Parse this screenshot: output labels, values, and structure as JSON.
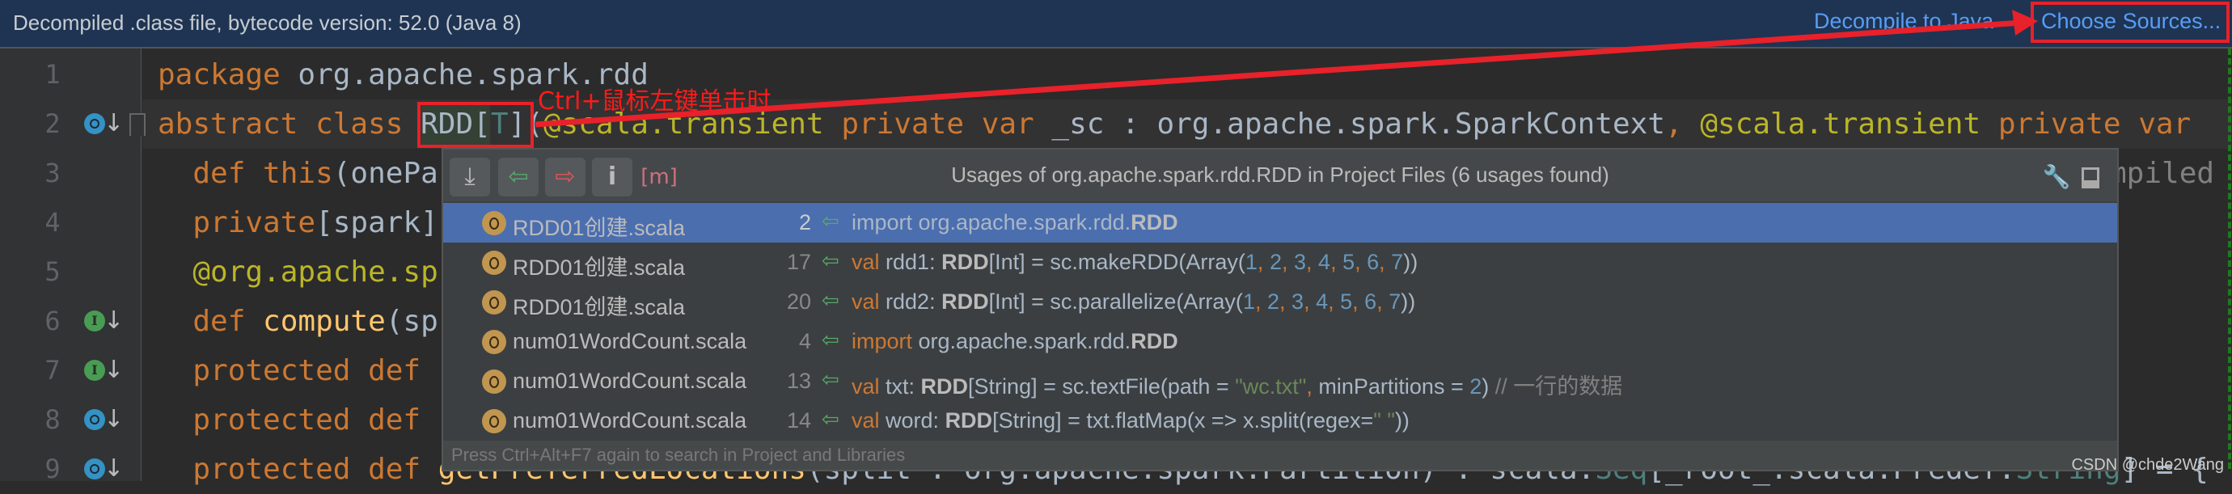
{
  "banner": {
    "message": "Decompiled .class file, bytecode version: 52.0 (Java 8)",
    "decompile_link": "Decompile to Java",
    "choose_sources_link": "Choose Sources..."
  },
  "annotation": {
    "text": "Ctrl+鼠标左键单击时",
    "color": "#ff1a1a"
  },
  "editor": {
    "line_numbers": [
      "1",
      "2",
      "3",
      "4",
      "5",
      "6",
      "7",
      "8",
      "9"
    ],
    "gutter_icons": {
      "2": "overridden-icon",
      "6": "implemented-icon",
      "7": "implemented-icon",
      "8": "overridden-icon",
      "9": "overridden-icon"
    },
    "lines": [
      [
        {
          "t": "kw",
          "text": "package "
        },
        {
          "t": "pl",
          "text": "org.apache.spark.rdd"
        }
      ],
      [
        {
          "t": "kw",
          "text": "abstract class "
        },
        {
          "t": "pl",
          "text": "RDD["
        },
        {
          "t": "tp",
          "text": "T"
        },
        {
          "t": "pl",
          "text": "]("
        },
        {
          "t": "ann",
          "text": "@scala.transient"
        },
        {
          "t": "kw",
          "text": " private var "
        },
        {
          "t": "pl",
          "text": "_sc : org.apache.spark.SparkContext"
        },
        {
          "t": "kw",
          "text": ", "
        },
        {
          "t": "ann",
          "text": "@scala.transient"
        },
        {
          "t": "kw",
          "text": " private var "
        }
      ],
      [
        {
          "t": "kw",
          "text": "  def this"
        },
        {
          "t": "pl",
          "text": "(onePa"
        },
        {
          "t": "cm",
          "text": "mpiled"
        }
      ],
      [
        {
          "t": "kw",
          "text": "  private"
        },
        {
          "t": "pl",
          "text": "[spark]"
        }
      ],
      [
        {
          "t": "ann",
          "text": "  @org.apache.sp"
        }
      ],
      [
        {
          "t": "kw",
          "text": "  def "
        },
        {
          "t": "me",
          "text": "compute"
        },
        {
          "t": "pl",
          "text": "(sp"
        }
      ],
      [
        {
          "t": "kw",
          "text": "  protected def"
        }
      ],
      [
        {
          "t": "kw",
          "text": "  protected def"
        }
      ],
      [
        {
          "t": "kw",
          "text": "  protected def "
        },
        {
          "t": "me",
          "text": "getPreferredLocations"
        },
        {
          "t": "pl",
          "text": "(split : org.apache.spark.Partition) : scala."
        },
        {
          "t": "tp",
          "text": "Seq"
        },
        {
          "t": "pl",
          "text": "[_root_.scala.Predef."
        },
        {
          "t": "tp",
          "text": "String"
        },
        {
          "t": "pl",
          "text": "] = {"
        }
      ]
    ]
  },
  "popup": {
    "title": "Usages of org.apache.spark.rdd.RDD in Project Files (6 usages found)",
    "toolbar": [
      "merge-usages-icon",
      "previous-usage-icon",
      "next-usage-icon",
      "info-icon",
      "module-icon"
    ],
    "footer": "Press Ctrl+Alt+F7 again to search in Project and Libraries",
    "selected_row": 0,
    "rows": [
      {
        "file": "RDD01创建.scala",
        "line": "2",
        "code": [
          {
            "t": "pl",
            "text": "import org.apache.spark.rdd."
          },
          {
            "t": "bold",
            "text": "RDD"
          }
        ]
      },
      {
        "file": "RDD01创建.scala",
        "line": "17",
        "code": [
          {
            "t": "kw",
            "text": "val "
          },
          {
            "t": "pl",
            "text": "rdd1: "
          },
          {
            "t": "bold",
            "text": "RDD"
          },
          {
            "t": "pl",
            "text": "[Int] = sc.makeRDD(Array("
          },
          {
            "t": "num",
            "text": "1"
          },
          {
            "t": "kw",
            "text": ", "
          },
          {
            "t": "num",
            "text": "2"
          },
          {
            "t": "kw",
            "text": ", "
          },
          {
            "t": "num",
            "text": "3"
          },
          {
            "t": "kw",
            "text": ", "
          },
          {
            "t": "num",
            "text": "4"
          },
          {
            "t": "kw",
            "text": ", "
          },
          {
            "t": "num",
            "text": "5"
          },
          {
            "t": "kw",
            "text": ", "
          },
          {
            "t": "num",
            "text": "6"
          },
          {
            "t": "kw",
            "text": ", "
          },
          {
            "t": "num",
            "text": "7"
          },
          {
            "t": "pl",
            "text": "))"
          }
        ]
      },
      {
        "file": "RDD01创建.scala",
        "line": "20",
        "code": [
          {
            "t": "kw",
            "text": "val "
          },
          {
            "t": "pl",
            "text": "rdd2: "
          },
          {
            "t": "bold",
            "text": "RDD"
          },
          {
            "t": "pl",
            "text": "[Int] = sc.parallelize(Array("
          },
          {
            "t": "num",
            "text": "1"
          },
          {
            "t": "kw",
            "text": ", "
          },
          {
            "t": "num",
            "text": "2"
          },
          {
            "t": "kw",
            "text": ", "
          },
          {
            "t": "num",
            "text": "3"
          },
          {
            "t": "kw",
            "text": ", "
          },
          {
            "t": "num",
            "text": "4"
          },
          {
            "t": "kw",
            "text": ", "
          },
          {
            "t": "num",
            "text": "5"
          },
          {
            "t": "kw",
            "text": ", "
          },
          {
            "t": "num",
            "text": "6"
          },
          {
            "t": "kw",
            "text": ", "
          },
          {
            "t": "num",
            "text": "7"
          },
          {
            "t": "pl",
            "text": "))"
          }
        ]
      },
      {
        "file": "num01WordCount.scala",
        "line": "4",
        "code": [
          {
            "t": "kw",
            "text": "import "
          },
          {
            "t": "pl",
            "text": "org.apache.spark.rdd."
          },
          {
            "t": "bold",
            "text": "RDD"
          }
        ]
      },
      {
        "file": "num01WordCount.scala",
        "line": "13",
        "code": [
          {
            "t": "kw",
            "text": "val "
          },
          {
            "t": "pl",
            "text": "txt: "
          },
          {
            "t": "bold",
            "text": "RDD"
          },
          {
            "t": "pl",
            "text": "[String] = sc.textFile(path = "
          },
          {
            "t": "str",
            "text": "\"wc.txt\""
          },
          {
            "t": "kw",
            "text": ", "
          },
          {
            "t": "pl",
            "text": "minPartitions = "
          },
          {
            "t": "num",
            "text": "2"
          },
          {
            "t": "pl",
            "text": ") "
          },
          {
            "t": "cm",
            "text": "// 一行的数据"
          }
        ]
      },
      {
        "file": "num01WordCount.scala",
        "line": "14",
        "code": [
          {
            "t": "kw",
            "text": "val "
          },
          {
            "t": "pl",
            "text": "word: "
          },
          {
            "t": "bold",
            "text": "RDD"
          },
          {
            "t": "pl",
            "text": "[String] = txt.flatMap(x => x.split(regex="
          },
          {
            "t": "str",
            "text": "\" \""
          },
          {
            "t": "pl",
            "text": "))"
          }
        ]
      }
    ]
  },
  "watermark": "CSDN @chde2Wang",
  "colors": {
    "banner": "#1e3452",
    "link": "#589df6",
    "selection": "#4b6eaf",
    "keyword": "#cc7832",
    "annotation_red": "#e8212a"
  }
}
